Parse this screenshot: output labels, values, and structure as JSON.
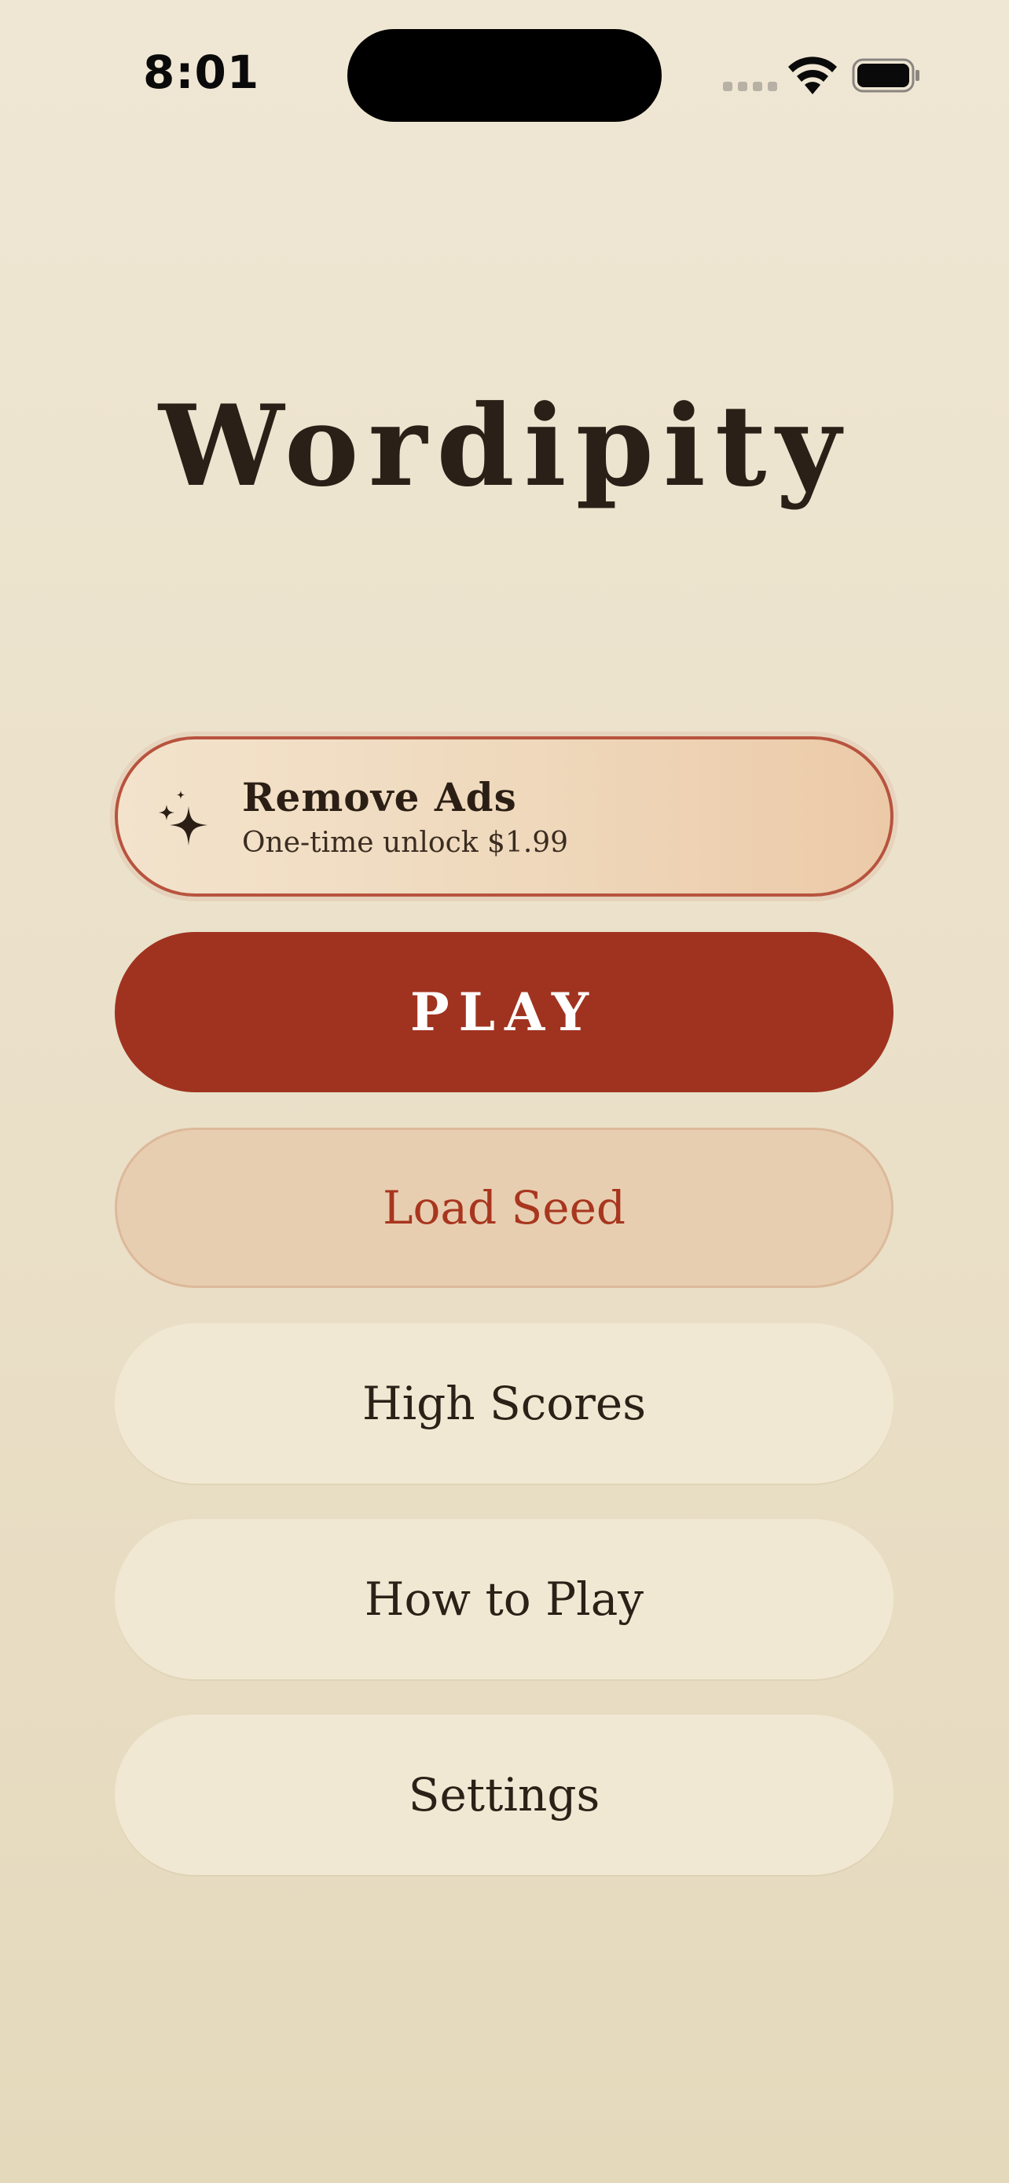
{
  "status_bar": {
    "time": "8:01"
  },
  "app": {
    "title": "Wordipity"
  },
  "menu": {
    "remove_ads": {
      "title": "Remove Ads",
      "subtitle": "One-time unlock $1.99",
      "icon": "sparkle-icon"
    },
    "play_label": "PLAY",
    "load_seed_label": "Load Seed",
    "high_scores_label": "High Scores",
    "how_to_play_label": "How to Play",
    "settings_label": "Settings"
  },
  "colors": {
    "background": "#efe7d4",
    "accent": "#a03320",
    "text": "#2b2117",
    "load_seed_fill": "#e8ceb0",
    "plain_button_fill": "#f1e8d3",
    "ads_border": "#b8533e"
  }
}
